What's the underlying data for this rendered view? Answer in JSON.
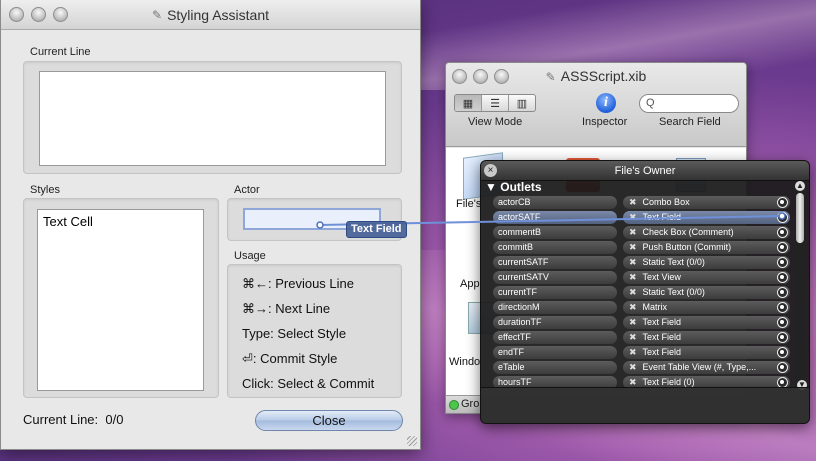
{
  "styling_assistant": {
    "title": "Styling Assistant",
    "current_line_label": "Current Line",
    "styles_label": "Styles",
    "styles_items": [
      "Text Cell"
    ],
    "actor_label": "Actor",
    "usage_label": "Usage",
    "usage_lines": [
      "⌘←: Previous Line",
      "⌘→: Next Line",
      "Type: Select Style",
      "⏎: Commit Style",
      "Click: Select & Commit"
    ],
    "status_label": "Current Line:",
    "status_value": "0/0",
    "close_button": "Close"
  },
  "xib_window": {
    "title": "ASSScript.xib",
    "toolbar": {
      "view_mode_label": "View Mode",
      "inspector_label": "Inspector",
      "search_label": "Search Field",
      "search_placeholder": "Q"
    },
    "objects": [
      {
        "label": "File's",
        "icon": "cube-icon"
      },
      {
        "label": "App",
        "icon": "app-icon"
      },
      {
        "label": "Windo",
        "icon": "window-icon"
      }
    ],
    "status_text": "Gro"
  },
  "drag_badge": "Text Field",
  "files_owner": {
    "title": "File's Owner",
    "section": "Outlets",
    "outlets": [
      {
        "name": "actorCB",
        "target": "Combo Box",
        "highlight": false
      },
      {
        "name": "actorSATF",
        "target": "Text Field",
        "highlight": true
      },
      {
        "name": "commentB",
        "target": "Check Box (Comment)",
        "highlight": false
      },
      {
        "name": "commitB",
        "target": "Push Button (Commit)",
        "highlight": false
      },
      {
        "name": "currentSATF",
        "target": "Static Text (0/0)",
        "highlight": false
      },
      {
        "name": "currentSATV",
        "target": "Text View",
        "highlight": false
      },
      {
        "name": "currentTF",
        "target": "Static Text (0/0)",
        "highlight": false
      },
      {
        "name": "directionM",
        "target": "Matrix",
        "highlight": false
      },
      {
        "name": "durationTF",
        "target": "Text Field",
        "highlight": false
      },
      {
        "name": "effectTF",
        "target": "Text Field",
        "highlight": false
      },
      {
        "name": "endTF",
        "target": "Text Field",
        "highlight": false
      },
      {
        "name": "eTable",
        "target": "Event Table View (#, Type,...",
        "highlight": false
      },
      {
        "name": "hoursTF",
        "target": "Text Field (0)",
        "highlight": false
      }
    ]
  }
}
